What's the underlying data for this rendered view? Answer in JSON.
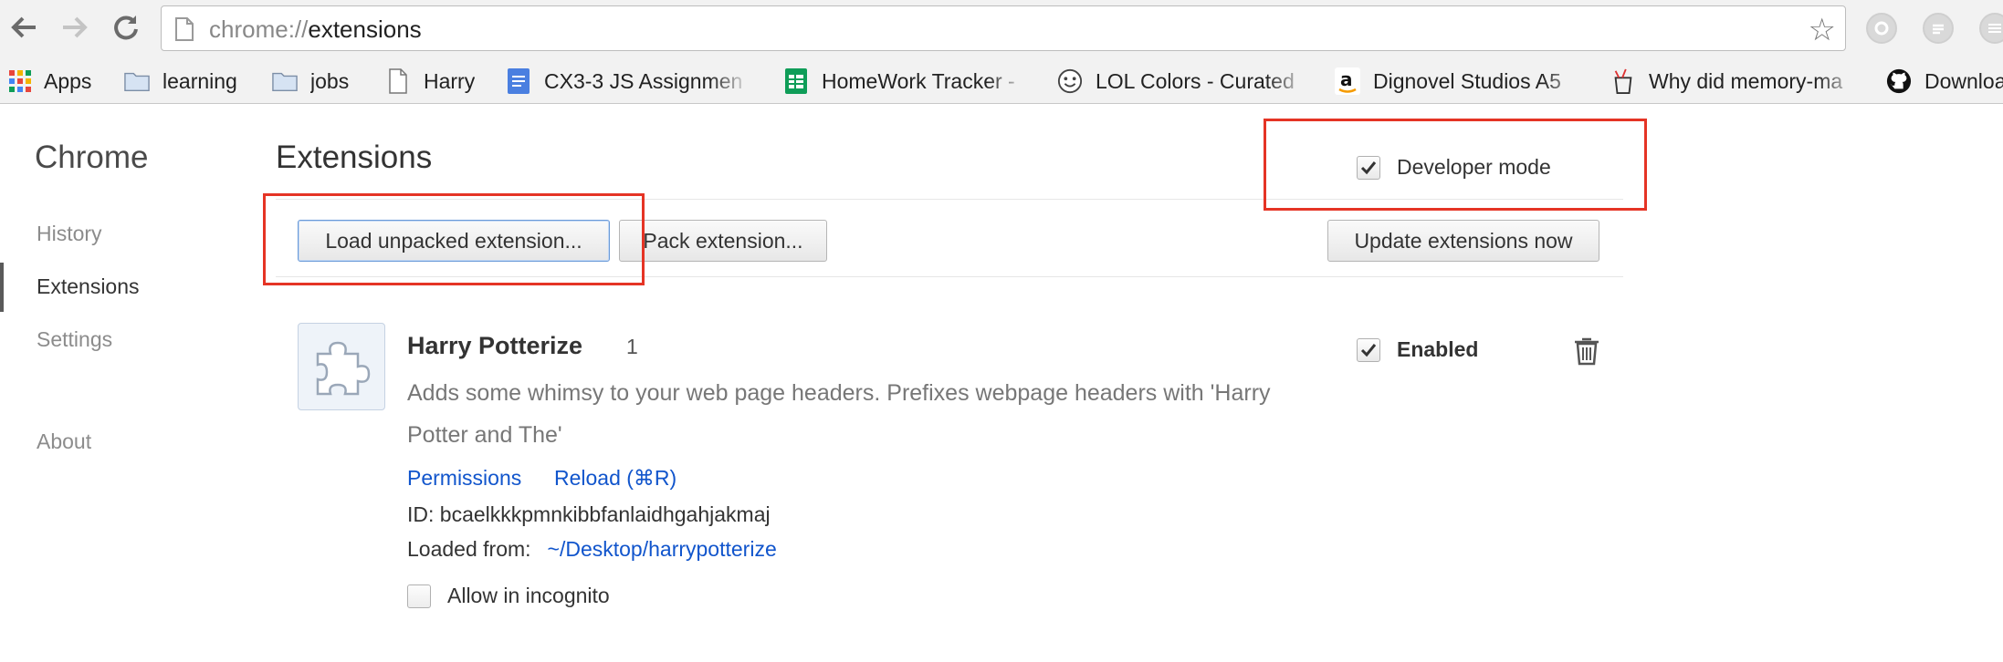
{
  "browser": {
    "url_scheme": "chrome://",
    "url_path": "extensions",
    "star_glyph": "☆"
  },
  "bookmarks": [
    {
      "label": "Apps",
      "icon": "apps-grid-icon"
    },
    {
      "label": "learning",
      "icon": "folder-icon"
    },
    {
      "label": "jobs",
      "icon": "folder-icon"
    },
    {
      "label": "Harry",
      "icon": "page-icon"
    },
    {
      "label": "CX3-3 JS Assignmen",
      "icon": "google-docs-icon"
    },
    {
      "label": "HomeWork Tracker -",
      "icon": "google-sheets-icon"
    },
    {
      "label": "LOL Colors - Curated",
      "icon": "lol-colors-icon"
    },
    {
      "label": "Dignovel Studios A5",
      "icon": "amazon-icon"
    },
    {
      "label": "Why did memory-ma",
      "icon": "trash-site-icon"
    },
    {
      "label": "Downloa",
      "icon": "github-icon"
    }
  ],
  "sidebar": {
    "title": "Chrome",
    "items": [
      {
        "label": "History"
      },
      {
        "label": "Extensions"
      },
      {
        "label": "Settings"
      },
      {
        "label": "About"
      }
    ]
  },
  "main": {
    "title": "Extensions",
    "developer_mode_label": "Developer mode",
    "load_unpacked_label": "Load unpacked extension...",
    "pack_label": "Pack extension...",
    "update_label": "Update extensions now"
  },
  "extension": {
    "name": "Harry Potterize",
    "version": "1",
    "description": "Adds some whimsy to your web page headers. Prefixes webpage headers with 'Harry Potter and The'",
    "permissions_link": "Permissions",
    "reload_link": "Reload (⌘R)",
    "id_line": "ID: bcaelkkkpmnkibbfanlaidhgahjakmaj",
    "loaded_from_label": "Loaded from:",
    "loaded_from_path": "~/Desktop/harrypotterize",
    "incognito_label": "Allow in incognito",
    "enabled_label": "Enabled"
  },
  "colors": {
    "link": "#1155cc",
    "highlight_box": "#e53425"
  }
}
